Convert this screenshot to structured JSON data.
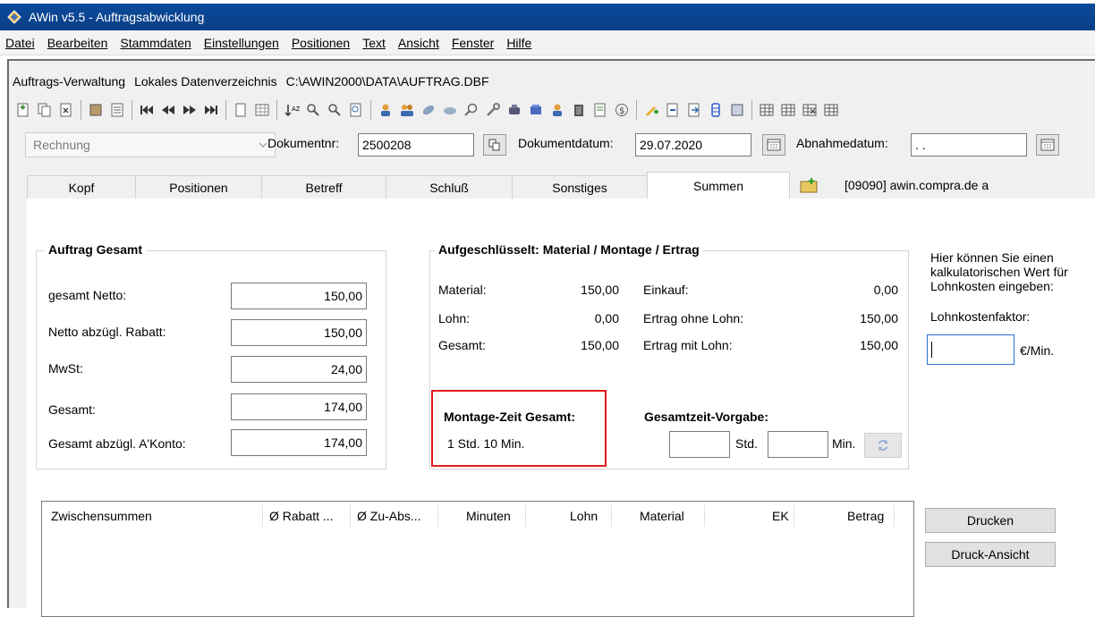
{
  "window": {
    "title": "AWin v5.5 - Auftragsabwicklung"
  },
  "menu": [
    "Datei",
    "Bearbeiten",
    "Stammdaten",
    "Einstellungen",
    "Positionen",
    "Text",
    "Ansicht",
    "Fenster",
    "Hilfe"
  ],
  "path": {
    "label1": "Auftrags-Verwaltung",
    "label2": "Lokales Datenverzeichnis",
    "value": "C:\\AWIN2000\\DATA\\AUFTRAG.DBF"
  },
  "doc": {
    "type_value": "Rechnung",
    "docnr_label": "Dokumentnr:",
    "docnr_value": "2500208",
    "date_label": "Dokumentdatum:",
    "date_value": "29.07.2020",
    "abnahme_label": "Abnahmedatum:",
    "abnahme_value": " . ."
  },
  "tabs": [
    "Kopf",
    "Positionen",
    "Betreff",
    "Schluß",
    "Sonstiges",
    "Summen"
  ],
  "customer": "[09090]  awin.compra.de  a",
  "auftrag": {
    "title": "Auftrag Gesamt",
    "rows": [
      {
        "label": "gesamt Netto:",
        "value": "150,00"
      },
      {
        "label": "Netto abzügl. Rabatt:",
        "value": "150,00"
      },
      {
        "label": "MwSt:",
        "value": "24,00"
      },
      {
        "label": "Gesamt:",
        "value": "174,00"
      },
      {
        "label": "Gesamt abzügl. A'Konto:",
        "value": "174,00"
      }
    ]
  },
  "aufgeschl": {
    "title": "Aufgeschlüsselt:  Material / Montage / Ertrag",
    "left": [
      {
        "label": "Material:",
        "value": "150,00"
      },
      {
        "label": "Lohn:",
        "value": "0,00"
      },
      {
        "label": "Gesamt:",
        "value": "150,00"
      }
    ],
    "right": [
      {
        "label": "Einkauf:",
        "value": "0,00"
      },
      {
        "label": "Ertrag ohne Lohn:",
        "value": "150,00"
      },
      {
        "label": "Ertrag mit Lohn:",
        "value": "150,00"
      }
    ],
    "montage_title": "Montage-Zeit Gesamt:",
    "montage_value": "1 Std. 10 Min.",
    "vorgabe_title": "Gesamtzeit-Vorgabe:",
    "std_label": "Std.",
    "min_label": "Min."
  },
  "hint": {
    "line1": "Hier können Sie einen",
    "line2": "kalkulatorischen Wert für",
    "line3": "Lohnkosten eingeben:",
    "factor_label": "Lohnkostenfaktor:",
    "unit": "€/Min."
  },
  "list": {
    "headers": [
      "Zwischensummen",
      "Ø Rabatt ...",
      "Ø Zu-Abs...",
      "Minuten",
      "Lohn",
      "Material",
      "EK",
      "Betrag"
    ]
  },
  "buttons": {
    "drucken": "Drucken",
    "druck_ansicht": "Druck-Ansicht"
  }
}
